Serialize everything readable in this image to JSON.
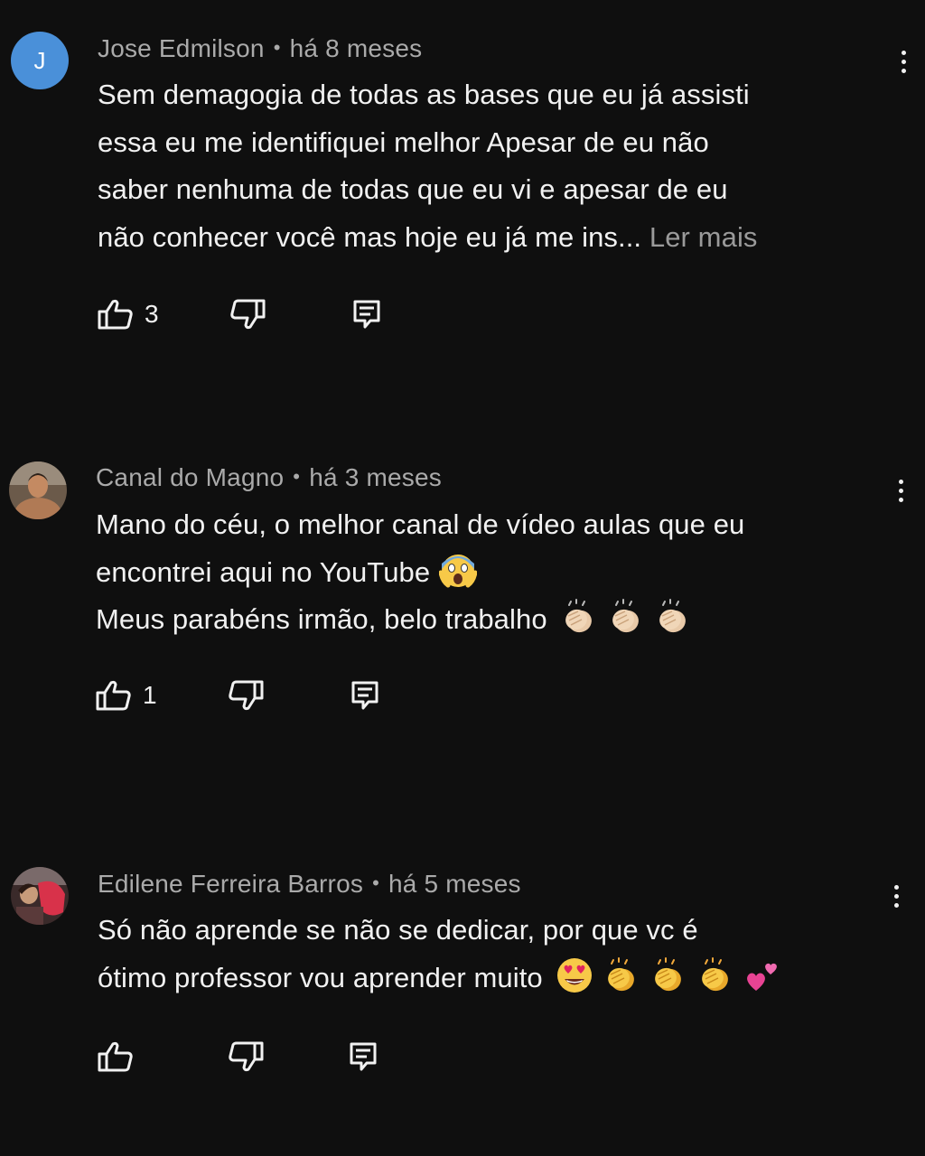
{
  "comments": [
    {
      "author": "Jose Edmilson",
      "separator": "•",
      "time": "há 8 meses",
      "avatar_letter": "J",
      "lines": [
        "Sem demagogia de todas as bases que eu já assisti",
        "essa eu me identifiquei melhor Apesar de eu não",
        "saber nenhuma de todas que eu vi e apesar de eu",
        "não conhecer você mas hoje eu já me ins... "
      ],
      "read_more": "Ler mais",
      "likes": "3"
    },
    {
      "author": "Canal do Magno",
      "separator": "•",
      "time": "há 3 meses",
      "lines": [
        "Mano do céu, o melhor canal de vídeo aulas que eu",
        "encontrei aqui no YouTube",
        "Meus parabéns irmão, belo trabalho"
      ],
      "emojis_line2": [
        "face-screaming-in-fear"
      ],
      "emojis_line3": [
        "clapping-hands-light",
        "clapping-hands-light",
        "clapping-hands-light"
      ],
      "likes": "1"
    },
    {
      "author": "Edilene Ferreira Barros",
      "separator": "•",
      "time": "há 5 meses",
      "lines": [
        "Só não aprende se não se dedicar, por que vc é",
        "ótimo professor vou aprender muito"
      ],
      "emojis_line2": [
        "heart-eyes",
        "clapping-hands",
        "clapping-hands",
        "clapping-hands",
        "two-hearts"
      ],
      "likes": ""
    }
  ],
  "colors": {
    "background": "#0f0f0f",
    "text": "#f1f1f1",
    "meta": "#aaaaaa",
    "avatar_letter_bg": "#4a90d9"
  },
  "icons": {
    "like": "thumb-up-icon",
    "dislike": "thumb-down-icon",
    "reply": "comment-reply-icon",
    "more": "more-vertical-icon"
  }
}
